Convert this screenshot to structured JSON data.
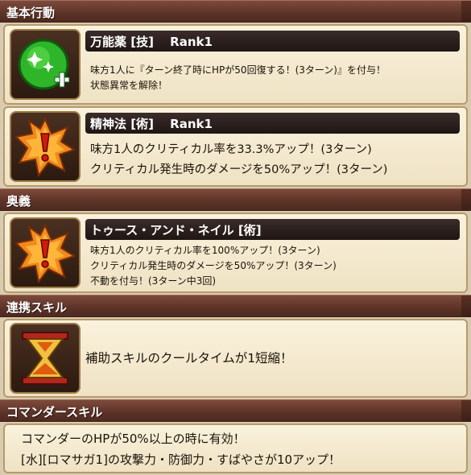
{
  "sections": {
    "basic": "基本行動",
    "ougi": "奥義",
    "renkei": "連携スキル",
    "commander": "コマンダースキル"
  },
  "skills": {
    "s1": {
      "title": "万能薬 [技]　 Rank1",
      "icon": "green-potion-heal-icon",
      "lines": [
        "味方1人に『ターン終了時にHPが50回復する！(3ターン)』を付与！",
        "状態異常を解除！"
      ]
    },
    "s2": {
      "title": "精神法 [術]　 Rank1",
      "icon": "exclamation-burst-icon",
      "lines": [
        "味方1人のクリティカル率を33.3%アップ！(3ターン)",
        "クリティカル発生時のダメージを50%アップ！(3ターン)"
      ]
    },
    "s3": {
      "title": "トゥース・アンド・ネイル [術]",
      "icon": "exclamation-burst-icon",
      "lines": [
        "味方1人のクリティカル率を100%アップ！(3ターン)",
        "クリティカル発生時のダメージを50%アップ！(3ターン)",
        "不動を付与！(3ターン中3回)"
      ]
    },
    "s4": {
      "icon": "hourglass-icon",
      "lines": [
        "補助スキルのクールタイムが1短縮！"
      ]
    },
    "commander": {
      "lines": [
        "コマンダーのHPが50%以上の時に有効！",
        "[水][ロマサガ1]の攻撃力・防御力・すばやさが10アップ！"
      ]
    }
  }
}
